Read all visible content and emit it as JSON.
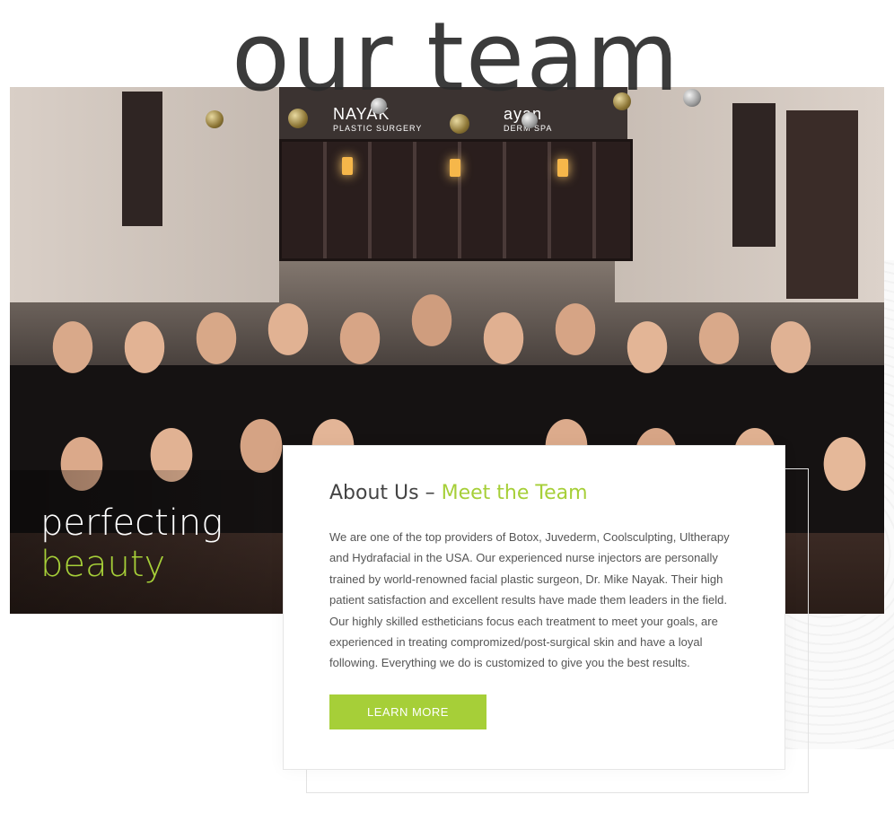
{
  "header": {
    "title": "our team"
  },
  "photo": {
    "signs": [
      {
        "name": "NAYAK",
        "sub": "PLASTIC SURGERY"
      },
      {
        "name": "ayan",
        "sub": "DERM SPA"
      }
    ]
  },
  "tagline": {
    "line1": "perfecting",
    "line2": "beauty"
  },
  "about": {
    "heading_prefix": "About Us – ",
    "heading_highlight": "Meet the Team",
    "body": "We are one of the top providers of Botox, Juvederm, Coolsculpting, Ultherapy and Hydrafacial in the USA. Our experienced nurse injectors are personally trained by world-renowned facial plastic surgeon, Dr. Mike Nayak. Their high patient satisfaction and excellent results have made them leaders in the field. Our highly skilled estheticians focus each treatment to meet your goals, are experienced in treating compromized/post-surgical skin and have a loyal following. Everything we do is customized to give you the best results.",
    "button_label": "LEARN MORE"
  },
  "colors": {
    "accent": "#a6cf38",
    "title": "#2b2b2b",
    "text": "#555555"
  }
}
